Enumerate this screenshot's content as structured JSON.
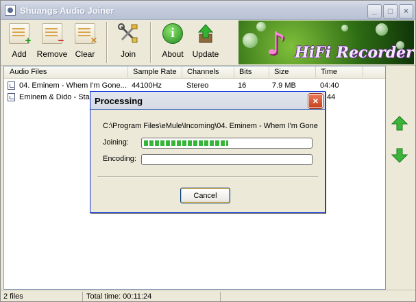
{
  "window": {
    "title": "Shuangs Audio Joiner",
    "controls": {
      "minimize": "_",
      "maximize": "□",
      "close": "×"
    }
  },
  "toolbar": {
    "add_label": "Add",
    "remove_label": "Remove",
    "clear_label": "Clear",
    "join_label": "Join",
    "about_label": "About",
    "update_label": "Update",
    "icons": {
      "add": "add-file-icon",
      "remove": "remove-file-icon",
      "clear": "clear-list-icon",
      "join": "join-tools-icon",
      "about": "info-icon",
      "update": "update-arrow-icon"
    }
  },
  "banner": {
    "text": "HiFi Recorder",
    "note_glyph": "♪"
  },
  "list": {
    "columns": [
      "Audio Files",
      "Sample Rate",
      "Channels",
      "Bits",
      "Size",
      "Time"
    ],
    "rows": [
      {
        "file": "04. Eminem - Whem I'm Gone....",
        "sample_rate": "44100Hz",
        "channels": "Stereo",
        "bits": "16",
        "size": "7.9 MB",
        "time": "04:40"
      },
      {
        "file": "Eminem & Dido - Stan...",
        "sample_rate": "",
        "channels": "",
        "bits": "",
        "size": "",
        "time": ":44"
      }
    ]
  },
  "side_arrows": {
    "up": "move-up-icon",
    "down": "move-down-icon"
  },
  "status": {
    "files": "2 files",
    "total_time": "Total time: 00:11:24"
  },
  "dialog": {
    "title": "Processing",
    "close": "×",
    "path": "C:\\Program Files\\eMule\\Incoming\\04. Eminem - Whem I'm Gone",
    "joining_label": "Joining:",
    "encoding_label": "Encoding:",
    "joining_progress": 0.51,
    "encoding_progress": 0,
    "cancel_label": "Cancel"
  },
  "colors": {
    "window_bg": "#ece9d8",
    "progress_green": "#37b53a",
    "arrow_green": "#2fa52c",
    "dialog_close_red": "#c8411c"
  }
}
